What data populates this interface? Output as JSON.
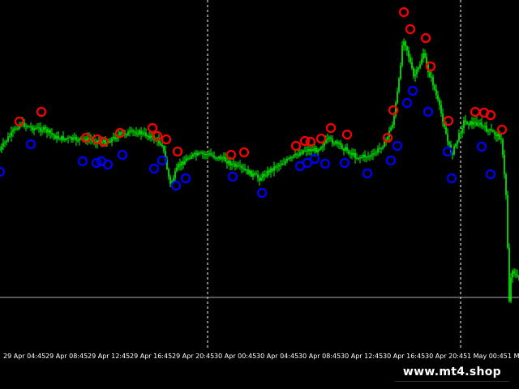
{
  "chart": {
    "background": "#000000",
    "candle_color": "#00ff00",
    "signal_up_color": "#ff0000",
    "signal_down_color": "#0000ff",
    "grid_color": "#ffffff",
    "price_line_color": "#b0b0b0"
  },
  "time_axis": {
    "labels": [
      "29 Apr 04:45",
      "29 Apr 08:45",
      "29 Apr 12:45",
      "29 Apr 16:45",
      "29 Apr 20:45",
      "30 Apr 00:45",
      "30 Apr 04:45",
      "30 Apr 08:45",
      "30 Apr 12:45",
      "30 Apr 16:45",
      "30 Apr 20:45",
      "1 May 00:45",
      "1 M"
    ]
  },
  "watermark": {
    "text": "www.mt4.shop"
  }
}
